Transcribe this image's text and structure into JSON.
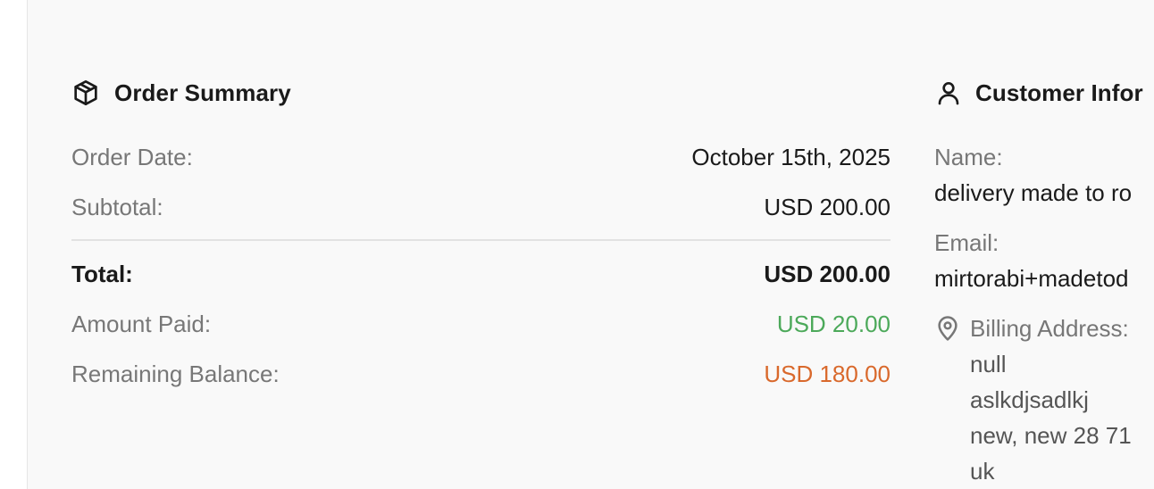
{
  "order_summary": {
    "title": "Order Summary",
    "icon": "package-icon",
    "order_date_label": "Order Date:",
    "order_date_value": "October 15th, 2025",
    "subtotal_label": "Subtotal:",
    "subtotal_value": "USD 200.00",
    "total_label": "Total:",
    "total_value": "USD 200.00",
    "amount_paid_label": "Amount Paid:",
    "amount_paid_value": "USD 20.00",
    "remaining_label": "Remaining Balance:",
    "remaining_value": "USD 180.00"
  },
  "customer_info": {
    "title": "Customer Infor",
    "icon": "user-icon",
    "name_label": "Name:",
    "name_value": "delivery made to ro",
    "email_label": "Email:",
    "email_value": "mirtorabi+madetod",
    "billing_label": "Billing Address:",
    "billing_icon": "map-pin-icon",
    "billing_lines": [
      "null",
      "aslkdjsadlkj",
      "new, new 28 71",
      "uk"
    ]
  },
  "colors": {
    "paid": "#4ca95a",
    "remaining": "#d9692c",
    "label": "#777777",
    "text": "#1a1a1a",
    "panel_bg": "#f9f9f9"
  }
}
